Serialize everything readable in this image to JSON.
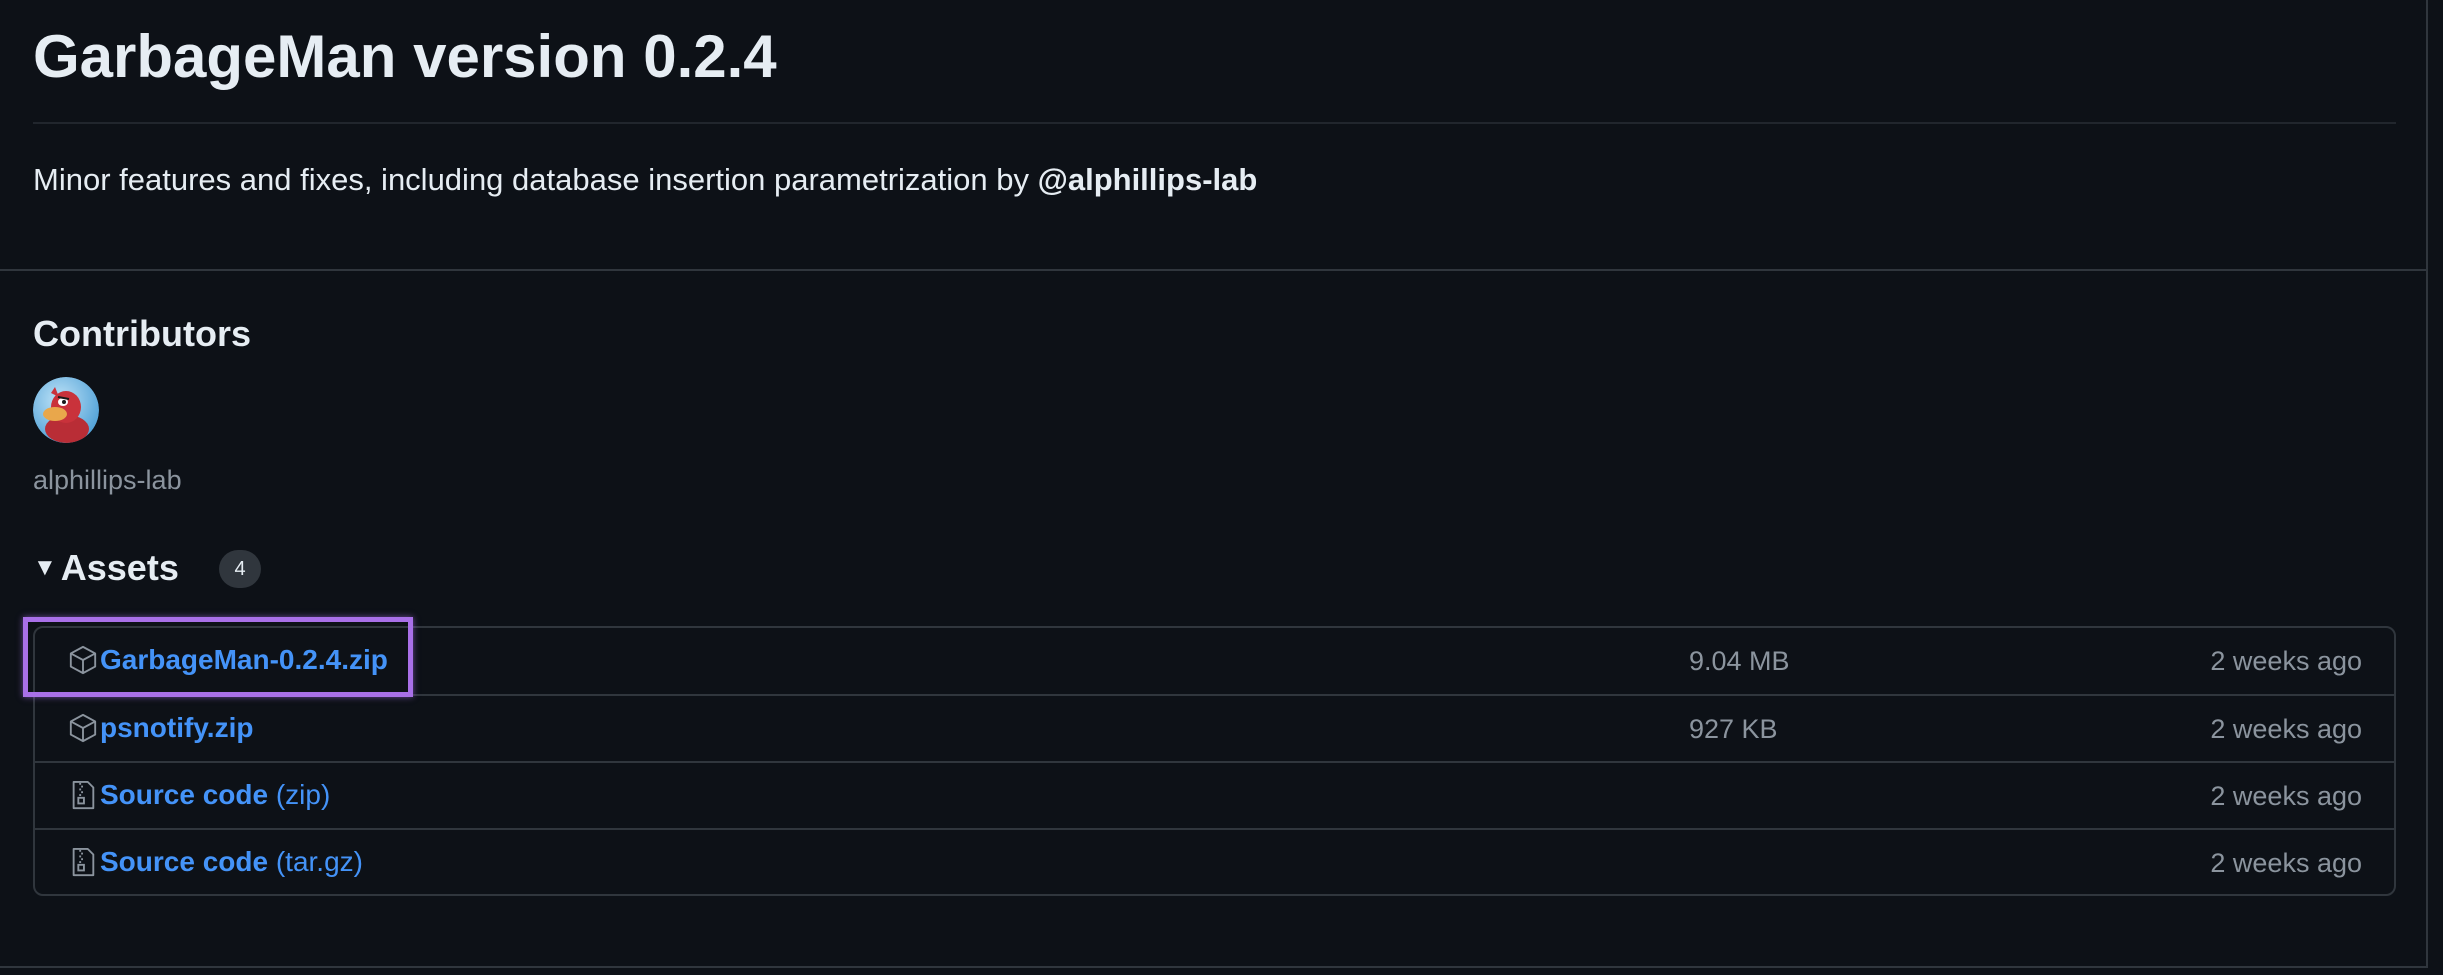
{
  "release": {
    "title": "GarbageMan version 0.2.4",
    "description_text": "Minor features and fixes, including database insertion parametrization by ",
    "description_mention": "@alphillips-lab"
  },
  "contributors": {
    "heading": "Contributors",
    "items": [
      {
        "name": "alphillips-lab",
        "avatar_icon": "duck-avatar"
      }
    ]
  },
  "assets": {
    "heading": "Assets",
    "count": "4",
    "toggle_icon": "triangle-down-icon",
    "items": [
      {
        "name": "GarbageMan-0.2.4.zip",
        "suffix": "",
        "size": "9.04 MB",
        "date": "2 weeks ago",
        "icon": "package-icon"
      },
      {
        "name": "psnotify.zip",
        "suffix": "",
        "size": "927 KB",
        "date": "2 weeks ago",
        "icon": "package-icon"
      },
      {
        "name": "Source code",
        "suffix": " (zip)",
        "size": "",
        "date": "2 weeks ago",
        "icon": "file-zip-icon"
      },
      {
        "name": "Source code",
        "suffix": " (tar.gz)",
        "size": "",
        "date": "2 weeks ago",
        "icon": "file-zip-icon"
      }
    ]
  },
  "colors": {
    "background": "#0d1117",
    "link": "#4493f8",
    "highlight": "#a970e8",
    "muted": "#8b949e"
  }
}
